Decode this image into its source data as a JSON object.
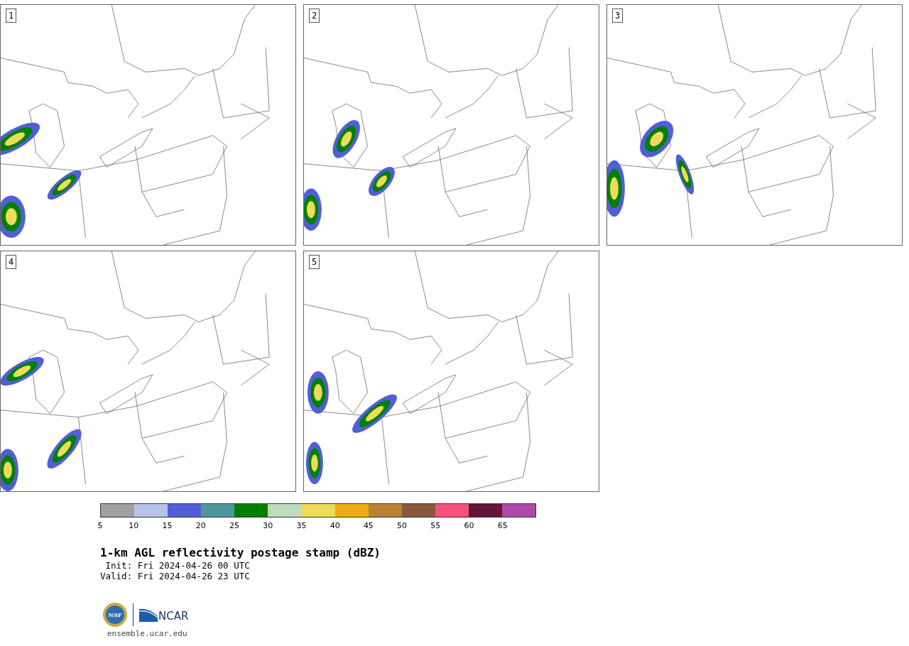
{
  "panels": [
    {
      "label": "1"
    },
    {
      "label": "2"
    },
    {
      "label": "3"
    },
    {
      "label": "4"
    },
    {
      "label": "5"
    }
  ],
  "colorbar": [
    {
      "color": "#a0a0a0",
      "label": "5"
    },
    {
      "color": "#b8c2ec",
      "label": "10"
    },
    {
      "color": "#525ed6",
      "label": "15"
    },
    {
      "color": "#4e979c",
      "label": "20"
    },
    {
      "color": "#008000",
      "label": "25"
    },
    {
      "color": "#bfdcbe",
      "label": "30"
    },
    {
      "color": "#eedb5a",
      "label": "35"
    },
    {
      "color": "#eeac17",
      "label": "40"
    },
    {
      "color": "#bb822f",
      "label": "45"
    },
    {
      "color": "#8a583c",
      "label": "50"
    },
    {
      "color": "#f4527d",
      "label": "55"
    },
    {
      "color": "#63163a",
      "label": "60"
    },
    {
      "color": "#ac4aa8",
      "label": "65"
    }
  ],
  "title": "1-km AGL reflectivity postage stamp (dBZ)",
  "init": " Init: Fri 2024-04-26 00 UTC",
  "valid": "Valid: Fri 2024-04-26 23 UTC",
  "logo": {
    "nsf": "NSF",
    "ncar": "NCAR"
  },
  "footer_url": "ensemble.ucar.edu"
}
